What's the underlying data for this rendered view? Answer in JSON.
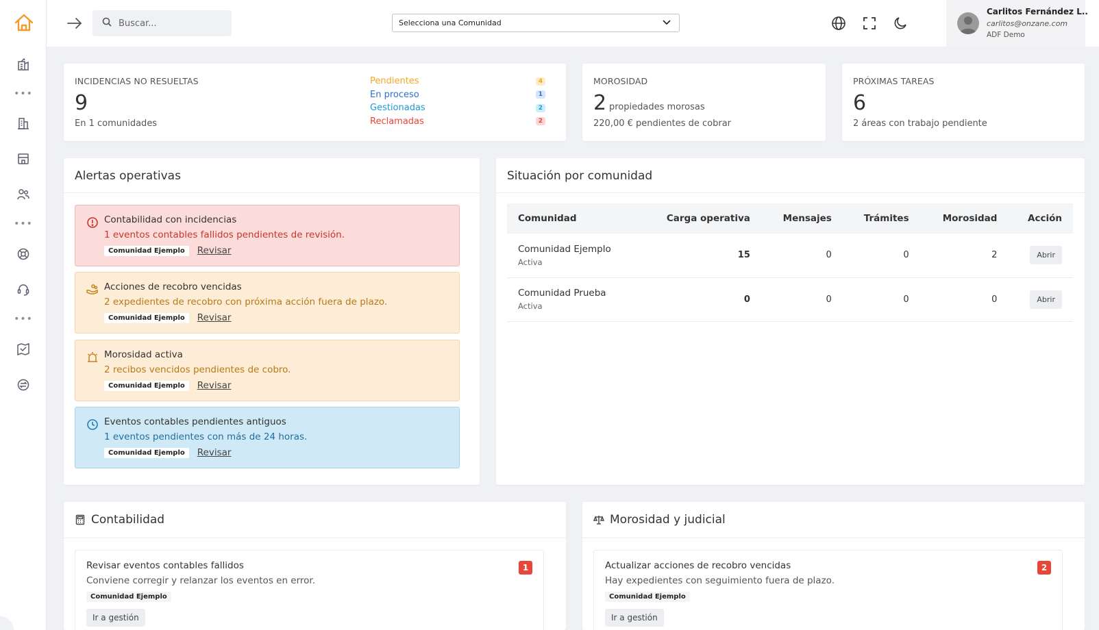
{
  "header": {
    "search_placeholder": "Buscar...",
    "community_select": "Selecciona una Comunidad",
    "user": {
      "name": "Carlitos Fernández L..",
      "email": "carlitos@onzane.com",
      "org": "ADF Demo"
    }
  },
  "kpis": {
    "incidencias": {
      "label": "INCIDENCIAS NO RESUELTAS",
      "value": "9",
      "sub": "En 1 comunidades",
      "statuses": [
        {
          "label": "Pendientes",
          "count": "4",
          "color": "#f5a623",
          "bg": "#fdecc8"
        },
        {
          "label": "En proceso",
          "count": "1",
          "color": "#2f6fc9",
          "bg": "#d6e6fb"
        },
        {
          "label": "Gestionadas",
          "count": "2",
          "color": "#1a9ad6",
          "bg": "#cdeefb"
        },
        {
          "label": "Reclamadas",
          "count": "2",
          "color": "#e8463a",
          "bg": "#fbd8d5"
        }
      ]
    },
    "morosidad": {
      "label": "MOROSIDAD",
      "value": "2",
      "inline": "propiedades morosas",
      "sub": "220,00 € pendientes de cobrar"
    },
    "tareas": {
      "label": "PRÓXIMAS TAREAS",
      "value": "6",
      "sub": "2 áreas con trabajo pendiente"
    }
  },
  "alerts": {
    "title": "Alertas operativas",
    "items": [
      {
        "icon": "alert-circle-icon",
        "title": "Contabilidad con incidencias",
        "desc": "1 eventos contables fallidos pendientes de revisión.",
        "tag": "Comunidad Ejemplo",
        "link": "Revisar"
      },
      {
        "icon": "hand-coins-icon",
        "title": "Acciones de recobro vencidas",
        "desc": "2 expedientes de recobro con próxima acción fuera de plazo.",
        "tag": "Comunidad Ejemplo",
        "link": "Revisar"
      },
      {
        "icon": "alarm-icon",
        "title": "Morosidad activa",
        "desc": "2 recibos vencidos pendientes de cobro.",
        "tag": "Comunidad Ejemplo",
        "link": "Revisar"
      },
      {
        "icon": "clock-icon",
        "title": "Eventos contables pendientes antiguos",
        "desc": "1 eventos pendientes con más de 24 horas.",
        "tag": "Comunidad Ejemplo",
        "link": "Revisar"
      }
    ]
  },
  "situacion": {
    "title": "Situación por comunidad",
    "columns": [
      "Comunidad",
      "Carga operativa",
      "Mensajes",
      "Trámites",
      "Morosidad",
      "Acción"
    ],
    "rows": [
      {
        "name": "Comunidad Ejemplo",
        "status": "Activa",
        "carga": "15",
        "mensajes": "0",
        "tramites": "0",
        "morosidad": "2",
        "action": "Abrir"
      },
      {
        "name": "Comunidad Prueba",
        "status": "Activa",
        "carga": "0",
        "mensajes": "0",
        "tramites": "0",
        "morosidad": "0",
        "action": "Abrir"
      }
    ]
  },
  "contabilidad": {
    "title": "Contabilidad",
    "task": {
      "title": "Revisar eventos contables fallidos",
      "desc": "Conviene corregir y relanzar los eventos en error.",
      "tag": "Comunidad Ejemplo",
      "button": "Ir a gestión",
      "count": "1"
    }
  },
  "judicial": {
    "title": "Morosidad y judicial",
    "task": {
      "title": "Actualizar acciones de recobro vencidas",
      "desc": "Hay expedientes con seguimiento fuera de plazo.",
      "tag": "Comunidad Ejemplo",
      "button": "Ir a gestión",
      "count": "2"
    }
  }
}
